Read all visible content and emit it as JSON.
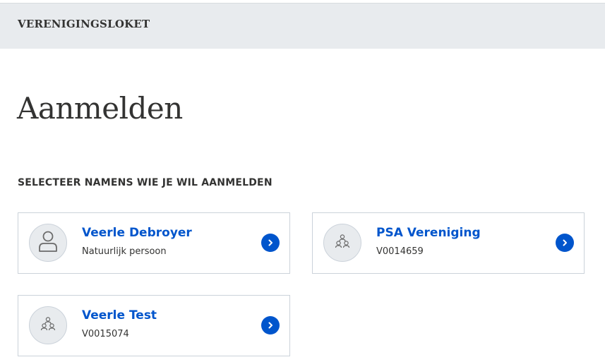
{
  "header": {
    "title": "VERENIGINGSLOKET"
  },
  "page": {
    "title": "Aanmelden",
    "section_label": "SELECTEER NAMENS WIE JE WIL AANMELDEN"
  },
  "accounts": [
    {
      "name": "Veerle Debroyer",
      "subtitle": "Natuurlijk persoon",
      "icon": "person-icon"
    },
    {
      "name": "PSA Vereniging",
      "subtitle": "V0014659",
      "icon": "group-icon"
    },
    {
      "name": "Veerle Test",
      "subtitle": "V0015074",
      "icon": "group-icon"
    }
  ],
  "colors": {
    "header_bg": "#e8ebee",
    "link": "#0055cc",
    "card_border": "#cbd2da",
    "text": "#333332"
  }
}
